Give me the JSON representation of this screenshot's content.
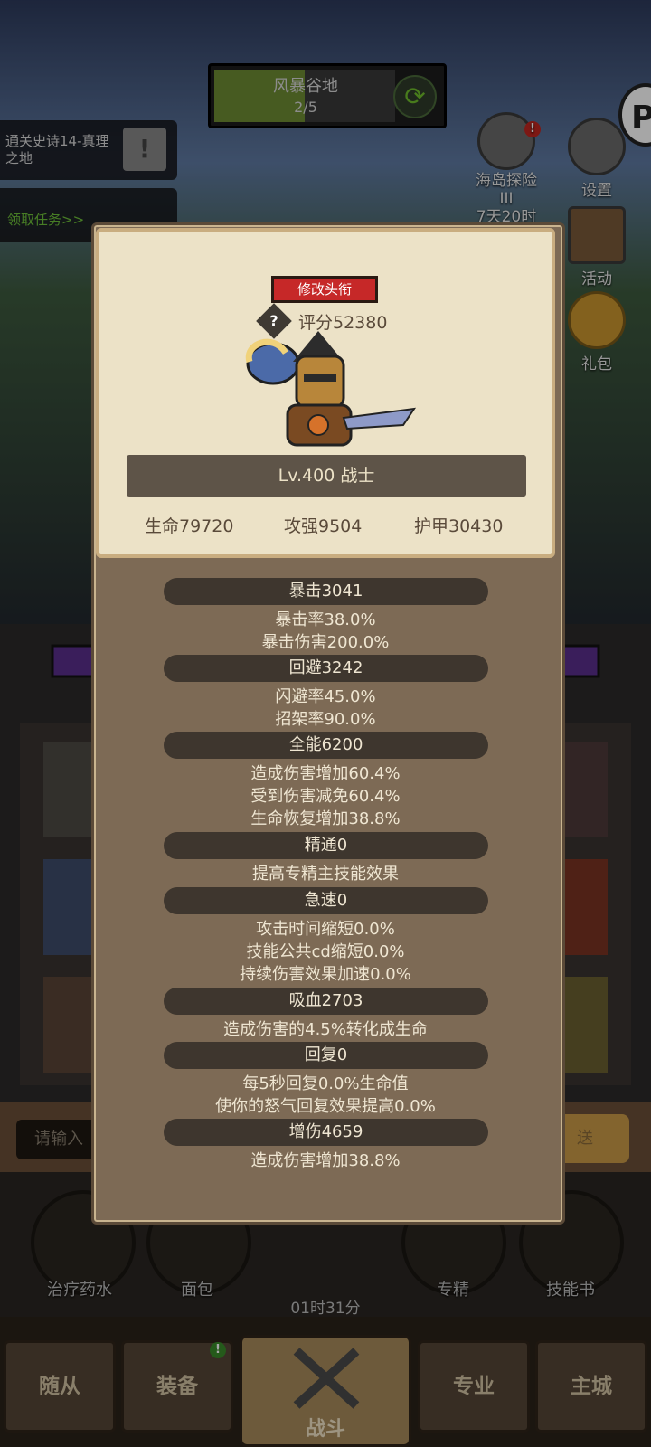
{
  "stage": {
    "name": "风暴谷地",
    "progress_text": "2/5",
    "progress": 0.4
  },
  "quests": [
    {
      "text": "通关史诗14-真理之地",
      "color": "#d8d8d8"
    },
    {
      "text": "领取任务>>",
      "color": "#6ec13a"
    }
  ],
  "right_menu": {
    "island": {
      "label": "海岛探险III",
      "sub": "7天20时",
      "badge": "!"
    },
    "settings": {
      "label": "设置"
    },
    "activity": {
      "label": "活动"
    },
    "gift": {
      "label": "礼包"
    }
  },
  "p_badge": "P",
  "profile": {
    "change_title": "修改头衔",
    "help": "?",
    "score": "评分52380",
    "level": "Lv.400 战士",
    "hp": "生命79720",
    "attack": "攻强9504",
    "armor": "护甲30430"
  },
  "stats": [
    {
      "head": "暴击3041",
      "lines": [
        "暴击率38.0%",
        "暴击伤害200.0%"
      ]
    },
    {
      "head": "回避3242",
      "lines": [
        "闪避率45.0%",
        "招架率90.0%"
      ]
    },
    {
      "head": "全能6200",
      "lines": [
        "造成伤害增加60.4%",
        "受到伤害减免60.4%",
        "生命恢复增加38.8%"
      ]
    },
    {
      "head": "精通0",
      "lines": [
        "提高专精主技能效果"
      ]
    },
    {
      "head": "急速0",
      "lines": [
        "攻击时间缩短0.0%",
        "技能公共cd缩短0.0%",
        "持续伤害效果加速0.0%"
      ]
    },
    {
      "head": "吸血2703",
      "lines": [
        "造成伤害的4.5%转化成生命"
      ]
    },
    {
      "head": "回复0",
      "lines": [
        "每5秒回复0.0%生命值",
        "使你的怒气回复效果提高0.0%"
      ]
    },
    {
      "head": "增伤4659",
      "lines": [
        "造成伤害增加38.8%"
      ]
    }
  ],
  "chat": {
    "placeholder": "请输入",
    "send": "送"
  },
  "quick_items": {
    "potion": "治疗药水",
    "bread": "面包",
    "spec": "专精",
    "skill_book": "技能书",
    "timer": "01时31分"
  },
  "tabs": {
    "follower": "随从",
    "equipment": "装备",
    "battle": "战斗",
    "profession": "专业",
    "city": "主城"
  },
  "colors": {
    "title_button": "#c62828",
    "panel": "#7d6a55",
    "card": "#ece2c7",
    "stat_pill": "#3e362e"
  }
}
